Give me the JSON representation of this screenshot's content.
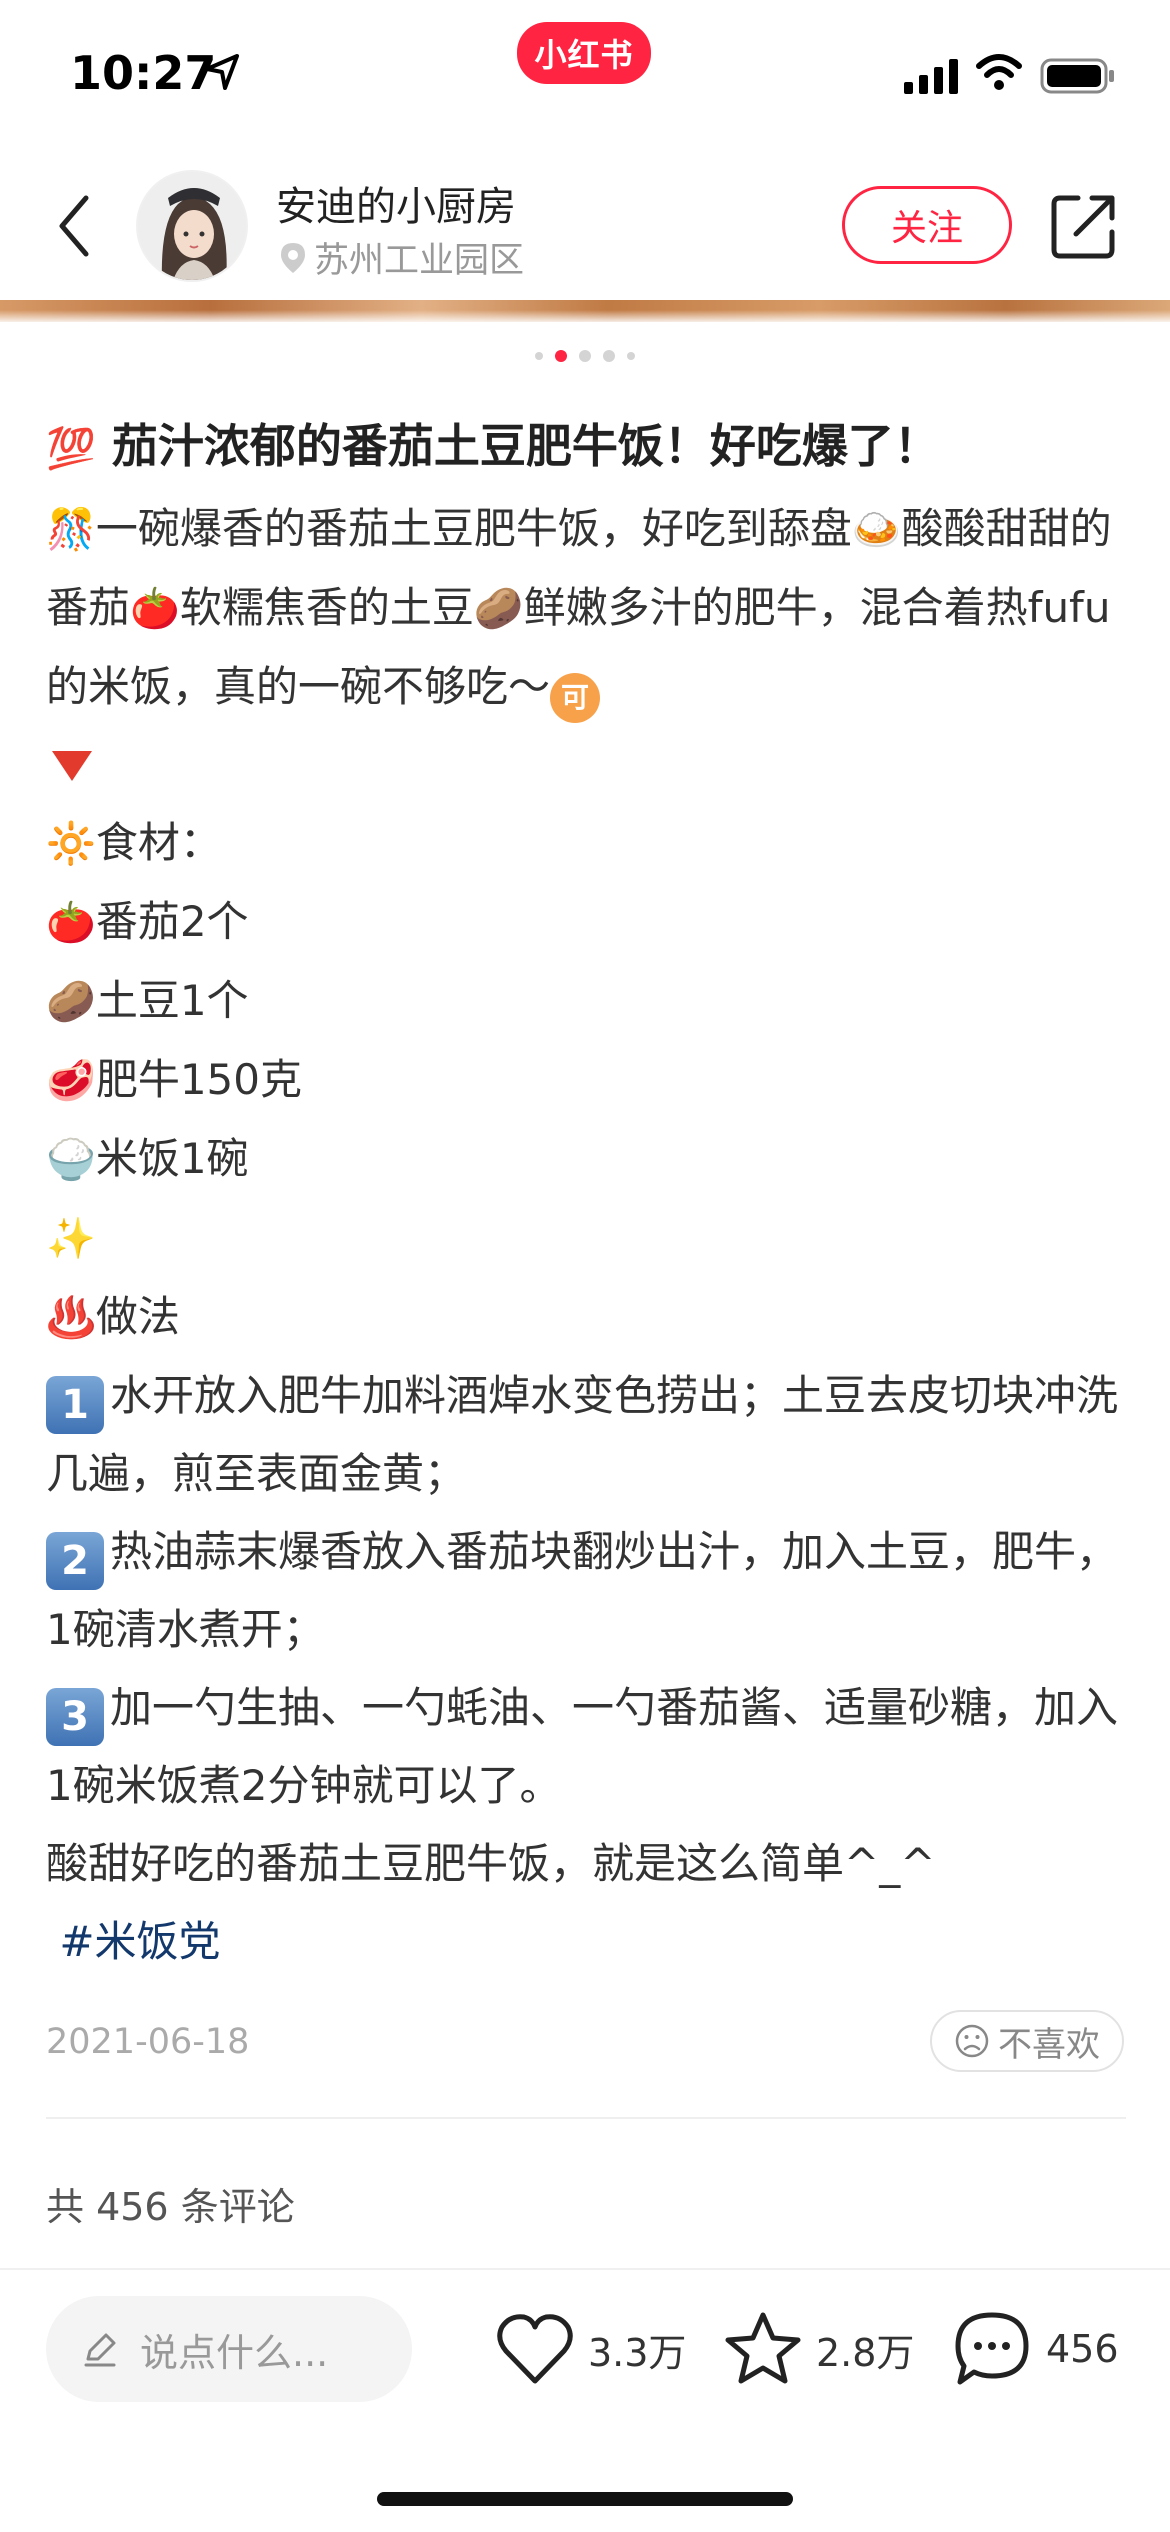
{
  "status_bar": {
    "time": "10:27",
    "app_badge": "小红书"
  },
  "header": {
    "author_name": "安迪的小厨房",
    "author_location": "苏州工业园区",
    "follow_label": "关注"
  },
  "gallery": {
    "page_count": 5,
    "active_index": 1
  },
  "post": {
    "title_emoji": "💯",
    "title": "茄汁浓郁的番茄土豆肥牛饭！好吃爆了！",
    "intro_emoji": "🎊",
    "intro_1": "一碗爆香的番茄土豆肥牛饭，好吃到舔盘",
    "intro_dish_emoji": "🍛",
    "intro_2": "酸酸甜甜的番茄",
    "tomato_emoji": "🍅",
    "intro_3": "软糯焦香的土豆",
    "potato_emoji": "🥔",
    "intro_4": "鲜嫩多汁的肥牛，混合着热fufu的米饭，真的一碗不够吃～",
    "ke_badge": "可",
    "sun_emoji": "🔆",
    "ingredients_heading": "食材：",
    "ingredients": [
      {
        "emoji": "🍅",
        "text": "番茄2个"
      },
      {
        "emoji": "🥔",
        "text": "土豆1个"
      },
      {
        "emoji": "🥩",
        "text": "肥牛150克"
      },
      {
        "emoji": "🍚",
        "text": "米饭1碗"
      }
    ],
    "sparkles_emoji": "✨",
    "steam_emoji": "♨️",
    "method_heading": "做法",
    "steps": [
      {
        "badge": "1",
        "text": "水开放入肥牛加料酒焯水变色捞出；土豆去皮切块冲洗几遍，煎至表面金黄；"
      },
      {
        "badge": "2",
        "text": "热油蒜末爆香放入番茄块翻炒出汁，加入土豆，肥牛，1碗清水煮开；"
      },
      {
        "badge": "3",
        "text": "加一勺生抽、一勺蚝油、一勺番茄酱、适量砂糖，加入1碗米饭煮2分钟就可以了。"
      }
    ],
    "closing": "酸甜好吃的番茄土豆肥牛饭，就是这么简单^_^",
    "hashtag": "#米饭党"
  },
  "meta": {
    "date": "2021-06-18",
    "dislike_label": "不喜欢",
    "comment_summary": "共 456 条评论"
  },
  "bottom_bar": {
    "input_placeholder": "说点什么...",
    "likes": "3.3万",
    "favorites": "2.8万",
    "comments": "456"
  },
  "colors": {
    "brand": "#ff2442",
    "hashtag": "#13386c",
    "muted": "#999999"
  }
}
